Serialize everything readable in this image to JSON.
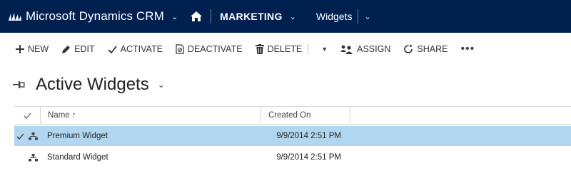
{
  "topbar": {
    "app_name": "Microsoft Dynamics CRM",
    "area": "MARKETING",
    "entity": "Widgets"
  },
  "commands": {
    "new": "NEW",
    "edit": "EDIT",
    "activate": "ACTIVATE",
    "deactivate": "DEACTIVATE",
    "delete": "DELETE",
    "assign": "ASSIGN",
    "share": "SHARE",
    "more": "•••"
  },
  "view": {
    "title": "Active Widgets"
  },
  "grid": {
    "columns": {
      "name": "Name ↑",
      "created_on": "Created On"
    },
    "rows": [
      {
        "name": "Premium Widget",
        "created_on": "9/9/2014 2:51 PM",
        "selected": true
      },
      {
        "name": "Standard Widget",
        "created_on": "9/9/2014 2:51 PM",
        "selected": false
      }
    ]
  },
  "colors": {
    "topbar_bg": "#002050",
    "selected_row_bg": "#b1d6f0"
  }
}
